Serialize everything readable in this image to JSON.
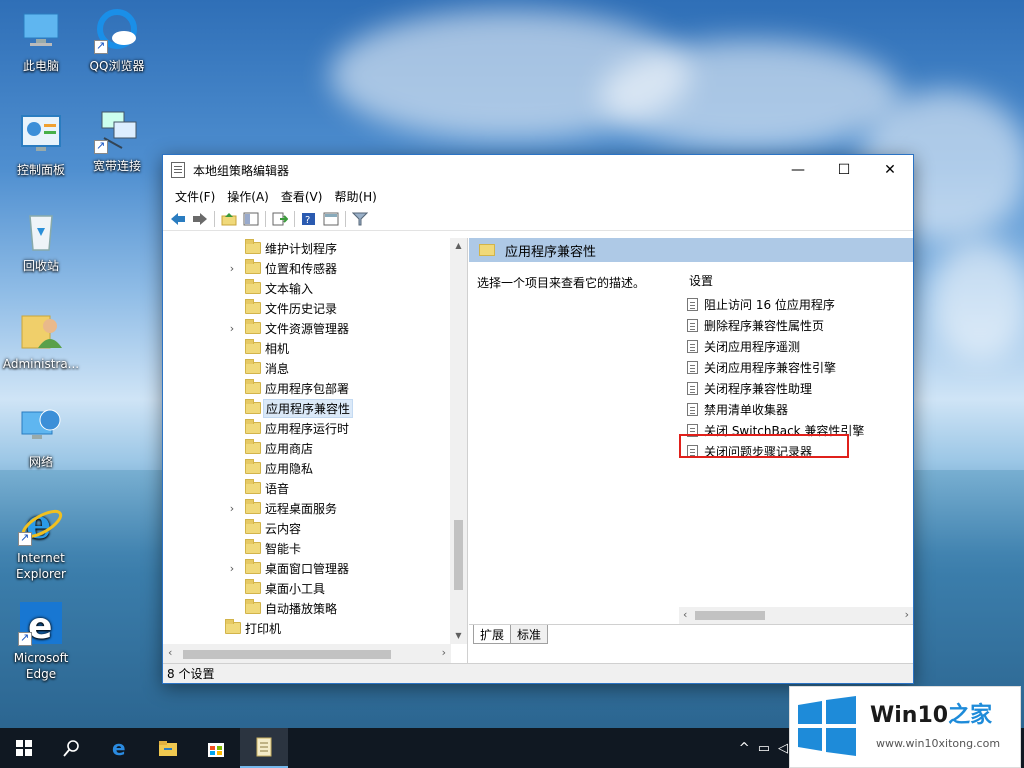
{
  "desktop": {
    "icons": [
      {
        "label": "此电脑"
      },
      {
        "label": "QQ浏览器"
      },
      {
        "label": "控制面板"
      },
      {
        "label": "宽带连接"
      },
      {
        "label": "回收站"
      },
      {
        "label": "Administra..."
      },
      {
        "label": "网络"
      },
      {
        "label": "Internet Explorer"
      },
      {
        "label": "Microsoft Edge"
      }
    ]
  },
  "window": {
    "title": "本地组策略编辑器",
    "minimize": "—",
    "maximize": "☐",
    "close": "✕",
    "menus": [
      "文件(F)",
      "操作(A)",
      "查看(V)",
      "帮助(H)"
    ],
    "tree": [
      {
        "label": "维护计划程序",
        "expandable": false
      },
      {
        "label": "位置和传感器",
        "expandable": true
      },
      {
        "label": "文本输入",
        "expandable": false
      },
      {
        "label": "文件历史记录",
        "expandable": false
      },
      {
        "label": "文件资源管理器",
        "expandable": true
      },
      {
        "label": "相机",
        "expandable": false
      },
      {
        "label": "消息",
        "expandable": false
      },
      {
        "label": "应用程序包部署",
        "expandable": false
      },
      {
        "label": "应用程序兼容性",
        "expandable": false,
        "selected": true
      },
      {
        "label": "应用程序运行时",
        "expandable": false
      },
      {
        "label": "应用商店",
        "expandable": false
      },
      {
        "label": "应用隐私",
        "expandable": false
      },
      {
        "label": "语音",
        "expandable": false
      },
      {
        "label": "远程桌面服务",
        "expandable": true
      },
      {
        "label": "云内容",
        "expandable": false
      },
      {
        "label": "智能卡",
        "expandable": false
      },
      {
        "label": "桌面窗口管理器",
        "expandable": true
      },
      {
        "label": "桌面小工具",
        "expandable": false
      },
      {
        "label": "自动播放策略",
        "expandable": false
      },
      {
        "label": "打印机",
        "expandable": false,
        "level1": true
      }
    ],
    "right": {
      "header": "应用程序兼容性",
      "description": "选择一个项目来查看它的描述。",
      "settings_title": "设置",
      "settings": [
        "阻止访问 16 位应用程序",
        "删除程序兼容性属性页",
        "关闭应用程序遥测",
        "关闭应用程序兼容性引擎",
        "关闭程序兼容性助理",
        "禁用清单收集器",
        "关闭 SwitchBack 兼容性引擎",
        "关闭问题步骤记录器"
      ],
      "tabs": [
        "扩展",
        "标准"
      ]
    },
    "status": "8 个设置"
  },
  "taskbar": {
    "start": "⊞",
    "search": "⚲",
    "edge": "e",
    "explorer": "▬",
    "store": "▣",
    "gpedit": "▤"
  },
  "tray": {
    "chevron": "^",
    "network": "▭",
    "volume": "◁"
  },
  "watermark": {
    "title_part1": "Win10",
    "title_part2": "之家",
    "url": "www.win10xitong.com"
  },
  "colors": {
    "window_border": "#2b73c4",
    "pane_header": "#aec9e6",
    "highlight_box": "#e0201b",
    "taskbar": "#101822",
    "win_logo": "#1e8bd9"
  }
}
